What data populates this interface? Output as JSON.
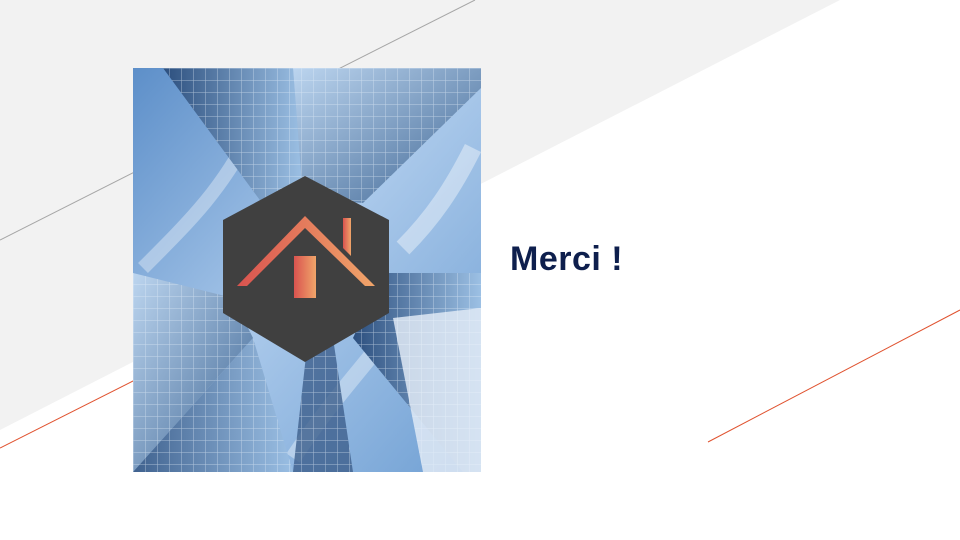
{
  "slide": {
    "title": "Merci !"
  },
  "colors": {
    "title": "#0e1f4d",
    "background_band": "#f2f2f2",
    "accent_line": "#e0522f",
    "gray_line": "#a6a6a6",
    "logo_hexagon": "#404040",
    "logo_house_start": "#d9534f",
    "logo_house_end": "#f0a56a"
  },
  "icons": {
    "logo": "house-icon"
  }
}
